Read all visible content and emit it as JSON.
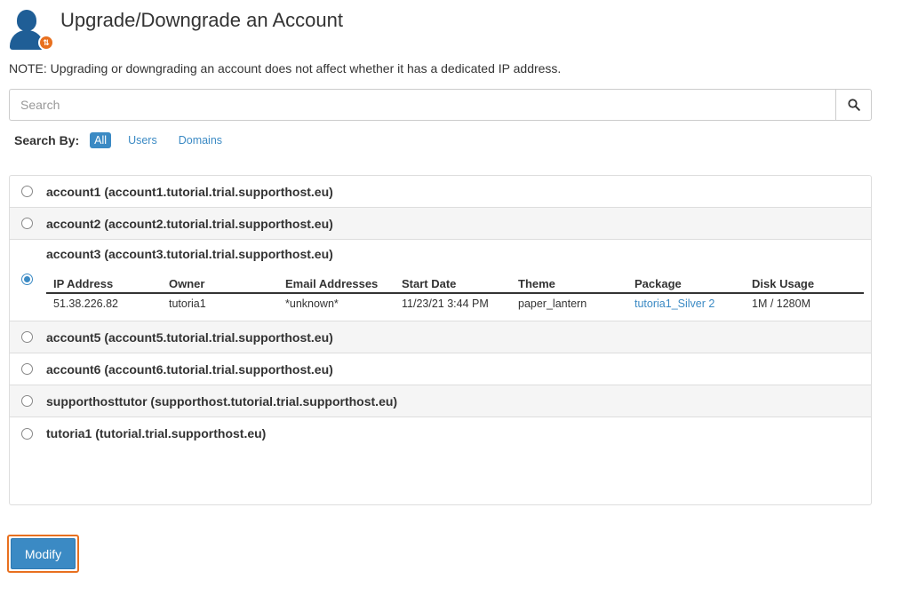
{
  "header": {
    "title": "Upgrade/Downgrade an Account",
    "icon": "user-transfer-icon",
    "badge_glyph": "⇅"
  },
  "note": "NOTE: Upgrading or downgrading an account does not affect whether it has a dedicated IP address.",
  "search": {
    "placeholder": "Search",
    "value": "",
    "button_icon": "search-icon"
  },
  "search_by": {
    "label": "Search By:",
    "options": [
      "All",
      "Users",
      "Domains"
    ],
    "selected": "All"
  },
  "accounts": [
    {
      "label": "account1 (account1.tutorial.trial.supporthost.eu)",
      "selected": false
    },
    {
      "label": "account2 (account2.tutorial.trial.supporthost.eu)",
      "selected": false
    },
    {
      "label": "account3 (account3.tutorial.trial.supporthost.eu)",
      "selected": true
    },
    {
      "label": "account5 (account5.tutorial.trial.supporthost.eu)",
      "selected": false
    },
    {
      "label": "account6 (account6.tutorial.trial.supporthost.eu)",
      "selected": false
    },
    {
      "label": "supporthosttutor (supporthost.tutorial.trial.supporthost.eu)",
      "selected": false
    },
    {
      "label": "tutoria1 (tutorial.trial.supporthost.eu)",
      "selected": false
    }
  ],
  "details": {
    "headers": [
      "IP Address",
      "Owner",
      "Email Addresses",
      "Start Date",
      "Theme",
      "Package",
      "Disk Usage"
    ],
    "values": [
      "51.38.226.82",
      "tutoria1",
      "*unknown*",
      "11/23/21 3:44 PM",
      "paper_lantern",
      "tutoria1_Silver 2",
      "1M / 1280M"
    ]
  },
  "modify_label": "Modify",
  "colors": {
    "accent": "#3b8ac4",
    "highlight": "#e8701f",
    "icon_blue": "#1f5e96"
  }
}
